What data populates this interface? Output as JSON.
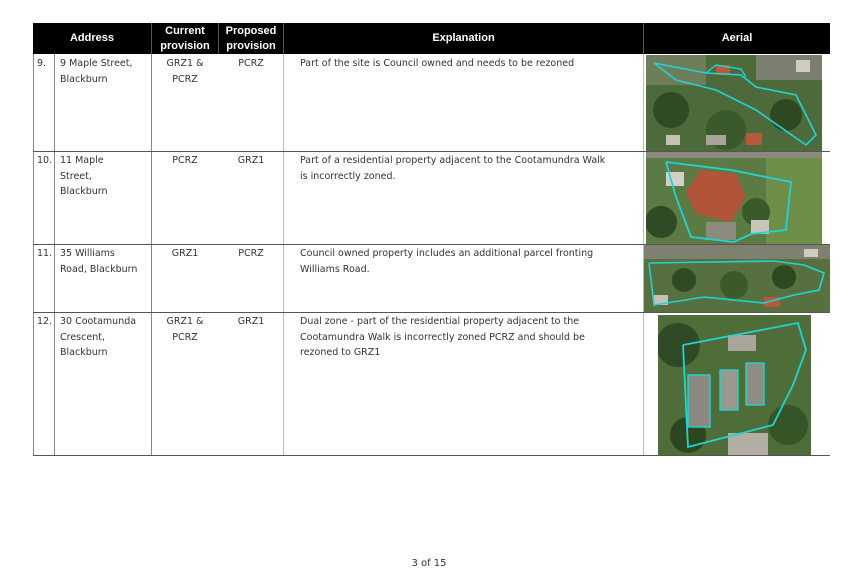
{
  "table": {
    "headers": {
      "address": "Address",
      "current": "Current provision",
      "current_l1": "Current",
      "current_l2": "provision",
      "proposed_l1": "Proposed",
      "proposed_l2": "provision",
      "explanation": "Explanation",
      "aerial": "Aerial"
    },
    "rows": [
      {
        "num": "9.",
        "address_lines": [
          "9 Maple Street,",
          "Blackburn"
        ],
        "current_lines": [
          "GRZ1 &",
          "PCRZ"
        ],
        "proposed": "PCRZ",
        "explanation_lines": [
          "Part of the site is Council owned and needs to be rezoned"
        ]
      },
      {
        "num": "10.",
        "address_lines": [
          "11 Maple",
          "Street,",
          "Blackburn"
        ],
        "current_lines": [
          "PCRZ"
        ],
        "proposed": "GRZ1",
        "explanation_lines": [
          "Part of a residential property adjacent to the Cootamundra Walk",
          "is incorrectly zoned."
        ]
      },
      {
        "num": "11.",
        "address_lines": [
          "35 Williams",
          "Road, Blackburn"
        ],
        "current_lines": [
          "GRZ1"
        ],
        "proposed": "PCRZ",
        "explanation_lines": [
          "Council owned property includes an additional parcel fronting",
          "Williams Road."
        ]
      },
      {
        "num": "12.",
        "address_lines": [
          "30 Cootamunda",
          "Crescent,",
          "Blackburn"
        ],
        "current_lines": [
          "GRZ1 &",
          "PCRZ"
        ],
        "proposed": "GRZ1",
        "explanation_lines": [
          "Dual zone - part of the residential property adjacent to the",
          "Cootamundra Walk is incorrectly zoned PCRZ and should be",
          "rezoned to GRZ1"
        ]
      }
    ]
  },
  "colors": {
    "header_bg": "#000000",
    "outline": "#22d3d3"
  },
  "footer": {
    "page": "3 of 15"
  }
}
